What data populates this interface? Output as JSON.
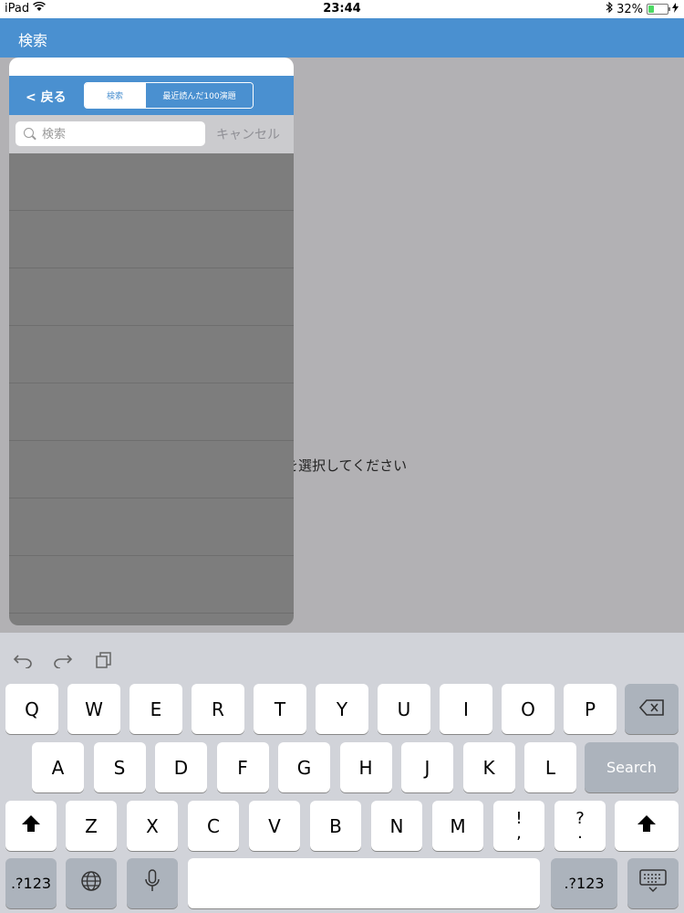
{
  "status": {
    "device": "iPad",
    "time": "23:44",
    "battery": "32%",
    "battery_level": 0.32
  },
  "nav": {
    "title": "検索"
  },
  "background": {
    "message": "を選択してください"
  },
  "popover": {
    "back_label": "< 戻る",
    "segments": [
      "検索",
      "最近読んだ100演題"
    ],
    "search": {
      "placeholder": "検索",
      "value": "",
      "cancel_label": "キャンセル"
    },
    "rows": 8
  },
  "keyboard": {
    "row1": [
      "Q",
      "W",
      "E",
      "R",
      "T",
      "Y",
      "U",
      "I",
      "O",
      "P"
    ],
    "row2": [
      "A",
      "S",
      "D",
      "F",
      "G",
      "H",
      "J",
      "K",
      "L"
    ],
    "row3": [
      "Z",
      "X",
      "C",
      "V",
      "B",
      "N",
      "M"
    ],
    "row3_punct": [
      [
        "!",
        ","
      ],
      [
        "?",
        "."
      ]
    ],
    "search_label": "Search",
    "num_label": ".?123",
    "icons": {
      "undo": "undo-icon",
      "redo": "redo-icon",
      "paste": "clipboard-icon",
      "delete": "backspace-icon",
      "shift": "shift-icon",
      "globe": "globe-icon",
      "mic": "microphone-icon",
      "hide": "keyboard-hide-icon"
    }
  }
}
